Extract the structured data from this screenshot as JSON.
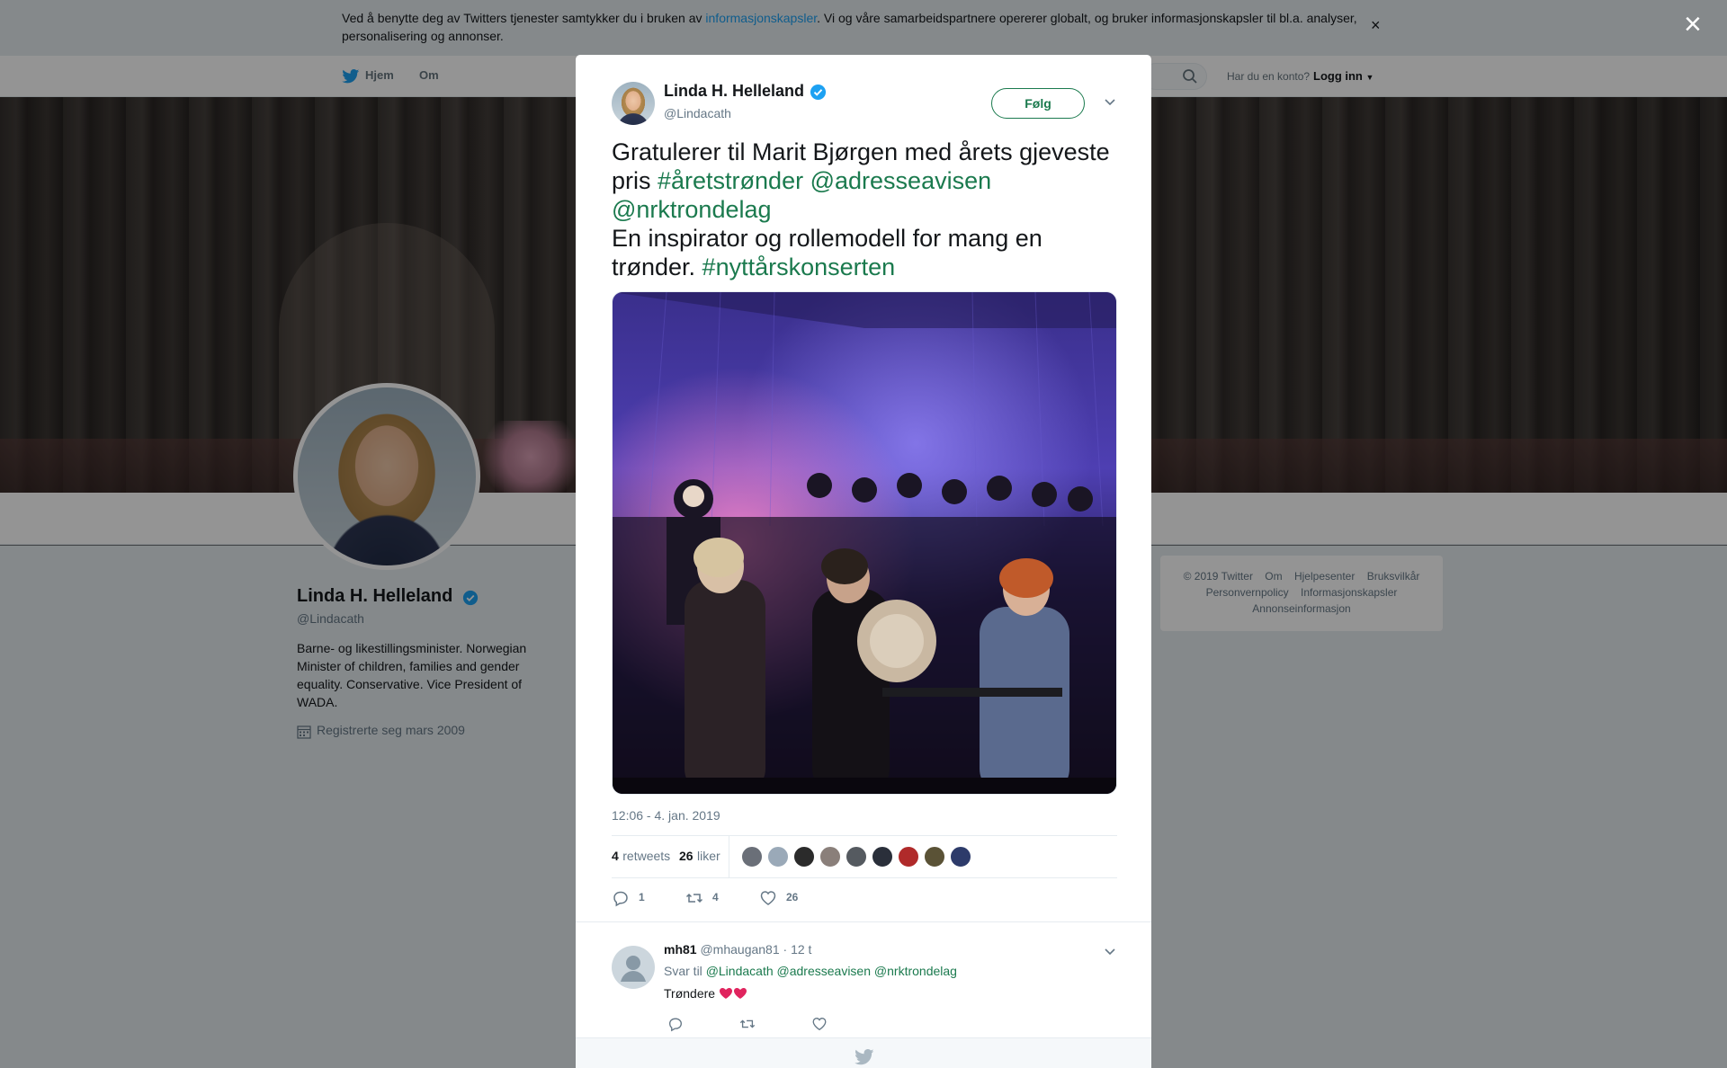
{
  "cookie_banner": {
    "text_before": "Ved å benytte deg av Twitters tjenester samtykker du i bruken av ",
    "link": "informasjonskapsler",
    "text_after": ". Vi og våre samarbeidspartnere opererer globalt, og bruker informasjonskapsler til bl.a. analyser, personalisering og annonser.",
    "dismiss": "×"
  },
  "nav": {
    "home": "Hjem",
    "about": "Om",
    "account_prompt": "Har du en konto?",
    "login": "Logg inn"
  },
  "profile": {
    "name": "Linda H. Helleland",
    "handle": "@Lindacath",
    "bio": "Barne- og likestillingsminister. Norwegian Minister of children, families and gender equality. Conservative. Vice President of WADA.",
    "joined": "Registrerte seg mars 2009"
  },
  "footer": {
    "links": [
      "© 2019 Twitter",
      "Om",
      "Hjelpesenter",
      "Bruksvilkår",
      "Personvernpolicy",
      "Informasjonskapsler",
      "Annonseinformasjon"
    ]
  },
  "modal": {
    "close": "×",
    "author_name": "Linda H. Helleland",
    "author_handle": "@Lindacath",
    "follow_label": "Følg",
    "tweet": {
      "line1": "Gratulerer til Marit Bjørgen med årets gjeveste pris ",
      "hashtag1": "#åretstrønder",
      "mention1": "@adresseavisen",
      "mention2": "@nrktrondelag",
      "line2": "En inspirator og rollemodell for mang en trønder. ",
      "hashtag2": "#nyttårskonserten"
    },
    "timestamp": "12:06 - 4. jan. 2019",
    "stats": {
      "retweets_count": "4",
      "retweets_label": "retweets",
      "likes_count": "26",
      "likes_label": "liker"
    },
    "liker_colors": [
      "#6a6f78",
      "#9aa9b8",
      "#2b2b2b",
      "#8a7f7a",
      "#555a60",
      "#2a2f3a",
      "#b02a2a",
      "#5a5236",
      "#2d3b6a"
    ],
    "actions": {
      "reply_count": "1",
      "retweet_count": "4",
      "like_count": "26"
    },
    "reply": {
      "username": "mh81",
      "handle": "@mhaugan81",
      "time": "· 12 t",
      "reply_to_label": "Svar til",
      "reply_to_1": "@Lindacath",
      "reply_to_2": "@adresseavisen",
      "reply_to_3": "@nrktrondelag",
      "text": "Trøndere"
    }
  },
  "colors": {
    "link": "#1b7a4e",
    "verified": "#1da1f2",
    "cookie_link": "#1da1f2"
  }
}
